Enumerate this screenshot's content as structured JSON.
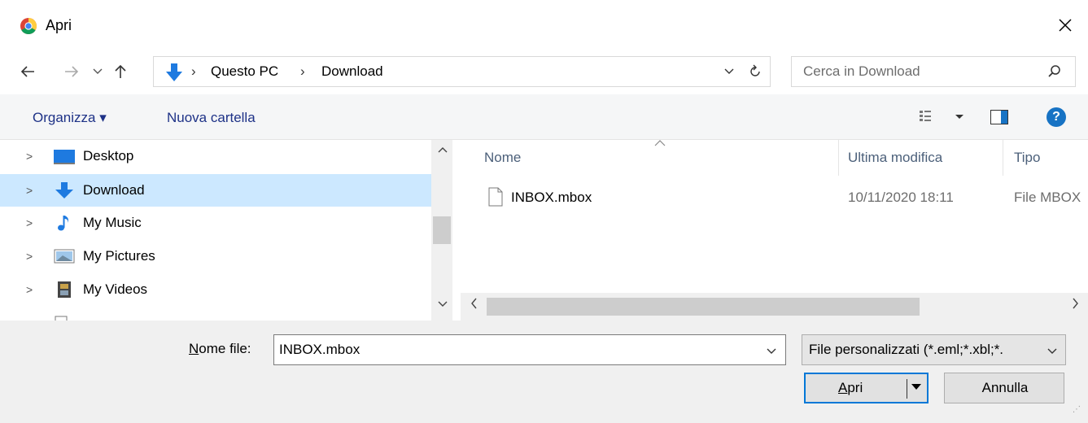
{
  "window": {
    "title": "Apri",
    "close_label": "✕"
  },
  "nav": {
    "back": "←",
    "forward": "→",
    "recent": "⌄",
    "up": "↑"
  },
  "address": {
    "crumbs": [
      "Questo PC",
      "Download"
    ],
    "separator": "›"
  },
  "search": {
    "placeholder": "Cerca in Download"
  },
  "toolbar": {
    "organize": "Organizza ▾",
    "new_folder": "Nuova cartella",
    "help": "?"
  },
  "tree": {
    "items": [
      {
        "label": "Desktop",
        "icon": "desktop-icon"
      },
      {
        "label": "Download",
        "icon": "download-icon",
        "selected": true
      },
      {
        "label": "My Music",
        "icon": "music-icon"
      },
      {
        "label": "My Pictures",
        "icon": "pictures-icon"
      },
      {
        "label": "My Videos",
        "icon": "videos-icon"
      }
    ]
  },
  "files": {
    "columns": {
      "name": "Nome",
      "modified": "Ultima modifica",
      "type": "Tipo"
    },
    "rows": [
      {
        "name": "INBOX.mbox",
        "modified": "10/11/2020 18:11",
        "type": "File MBOX"
      }
    ]
  },
  "bottom": {
    "filename_label_underlined": "N",
    "filename_label_rest": "ome file:",
    "filename_value": "INBOX.mbox",
    "filter": "File personalizzati (*.eml;*.xbl;*.",
    "open_underlined": "A",
    "open_rest": "pri",
    "cancel": "Annulla"
  },
  "colors": {
    "accent": "#0078d7",
    "selection": "#cce8ff",
    "toolbar_link": "#1e3287",
    "help": "#1773c4"
  }
}
